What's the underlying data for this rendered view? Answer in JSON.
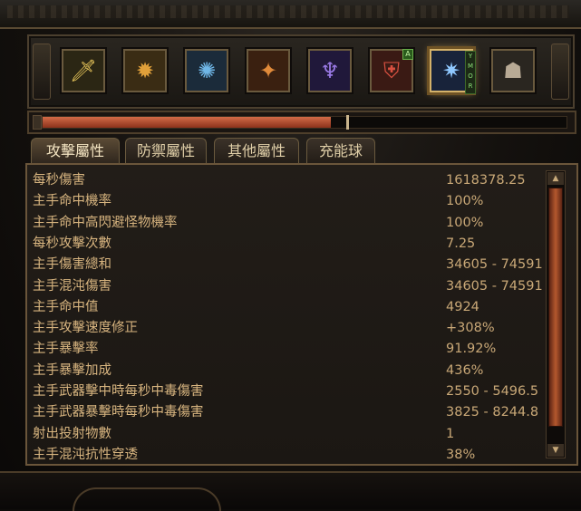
{
  "skills": [
    {
      "icon": "sword-icon",
      "bg": "#2b2614",
      "glyph": "🗡",
      "color": "#e8c65a"
    },
    {
      "icon": "shield-crest-icon",
      "bg": "#3a2c14",
      "glyph": "✹",
      "color": "#e0a03a"
    },
    {
      "icon": "blue-wheel-icon",
      "bg": "#1b2b3a",
      "glyph": "✺",
      "color": "#6fb6e6"
    },
    {
      "icon": "dragon-fire-icon",
      "bg": "#3a2010",
      "glyph": "✦",
      "color": "#e08a3a"
    },
    {
      "icon": "spirit-figure-icon",
      "bg": "#20183a",
      "glyph": "♆",
      "color": "#9a7ae6"
    },
    {
      "icon": "red-shield-icon",
      "bg": "#3a1a14",
      "glyph": "⛨",
      "color": "#d85040"
    },
    {
      "icon": "lightning-orb-icon",
      "bg": "#18233a",
      "glyph": "✷",
      "color": "#8fc8ff"
    },
    {
      "icon": "stone-golem-icon",
      "bg": "#2a2620",
      "glyph": "☗",
      "color": "#b8aa95"
    }
  ],
  "skill_badge": "A",
  "rune_marks": [
    "Y",
    "M",
    "O",
    "R"
  ],
  "resource": {
    "fill_fraction": 0.55
  },
  "tabs": [
    "攻擊屬性",
    "防禦屬性",
    "其他屬性",
    "充能球"
  ],
  "active_tab": 0,
  "stats": [
    {
      "label": "每秒傷害",
      "value": "1618378.25"
    },
    {
      "label": "主手命中機率",
      "value": "100%"
    },
    {
      "label": "主手命中高閃避怪物機率",
      "value": "100%"
    },
    {
      "label": "每秒攻擊次數",
      "value": "7.25"
    },
    {
      "label": "主手傷害總和",
      "value": "34605 - 74591"
    },
    {
      "label": "主手混沌傷害",
      "value": "34605 - 74591"
    },
    {
      "label": "主手命中值",
      "value": "4924"
    },
    {
      "label": "主手攻擊速度修正",
      "value": "+308%"
    },
    {
      "label": "主手暴擊率",
      "value": "91.92%"
    },
    {
      "label": "主手暴擊加成",
      "value": "436%"
    },
    {
      "label": "主手武器擊中時每秒中毒傷害",
      "value": "2550 - 5496.5"
    },
    {
      "label": "主手武器暴擊時每秒中毒傷害",
      "value": "3825 - 8244.8"
    },
    {
      "label": "射出投射物數",
      "value": "1"
    },
    {
      "label": "主手混沌抗性穿透",
      "value": "38%"
    }
  ],
  "colors": {
    "label": "#d7b47f",
    "value": "#c9a877",
    "accent": "#d4b26a"
  }
}
